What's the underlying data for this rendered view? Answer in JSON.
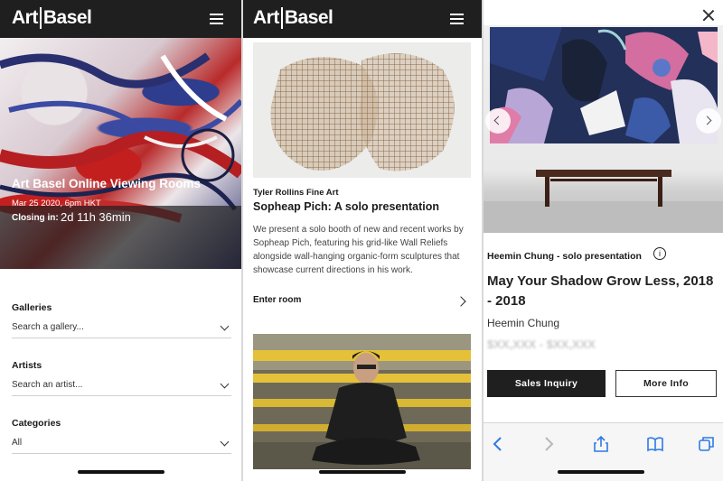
{
  "brand": {
    "logo_left": "Art",
    "logo_right": "Basel"
  },
  "panel1": {
    "hero": {
      "title": "Art Basel Online Viewing Rooms",
      "date": "Mar 25 2020, 6pm HKT",
      "closing_label": "Closing in:",
      "closing_value": "2d 11h 36min"
    },
    "filters": [
      {
        "label": "Galleries",
        "placeholder": "Search a gallery..."
      },
      {
        "label": "Artists",
        "placeholder": "Search an artist..."
      },
      {
        "label": "Categories",
        "value": "All"
      }
    ]
  },
  "panel2": {
    "gallery": "Tyler Rollins Fine Art",
    "title": "Sopheap Pich: A solo presentation",
    "description": "We present a solo booth of new and recent works by Sopheap Pich, featuring his grid-like Wall Reliefs alongside wall-hanging organic-form sculptures that showcase current directions in his work.",
    "enter_label": "Enter room"
  },
  "panel3": {
    "subtitle": "Heemin Chung - solo presentation",
    "info_icon_glyph": "i",
    "title": "May Your Shadow Grow Less, 2018 - 2018",
    "artist": "Heemin Chung",
    "price_blurred": "$XX,XXX - $XX,XXX",
    "sales_button": "Sales Inquiry",
    "more_button": "More Info"
  },
  "colors": {
    "topbar": "#1f1f1f",
    "dark_button": "#1f1f1f",
    "overlay": "#232323"
  },
  "icons": [
    "menu-icon",
    "chevron-down-icon",
    "chevron-right-icon",
    "close-icon",
    "info-icon",
    "back-icon",
    "forward-icon",
    "share-icon",
    "bookmarks-icon",
    "tabs-icon"
  ]
}
